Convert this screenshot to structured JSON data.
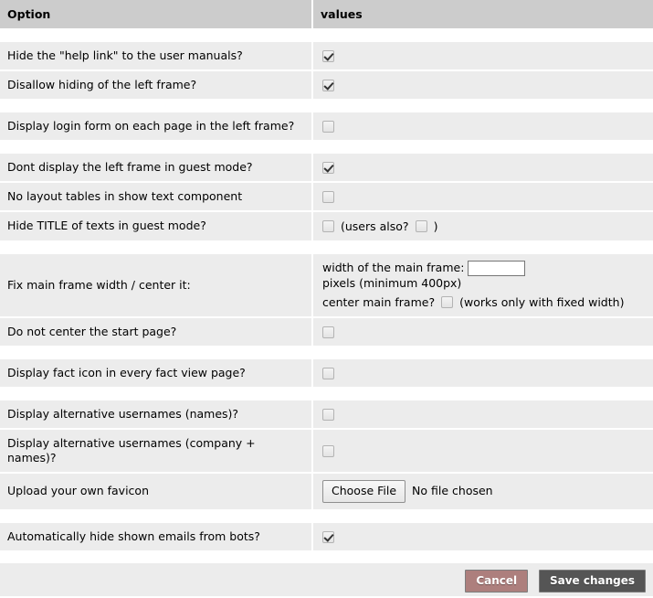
{
  "table": {
    "headers": {
      "option": "Option",
      "values": "values"
    },
    "blocks": [
      {
        "rows": [
          {
            "label": "Hide the \"help link\" to the user manuals?",
            "type": "checkbox",
            "checked": true,
            "name": "hide-help-link"
          },
          {
            "label": "Disallow hiding of the left frame?",
            "type": "checkbox",
            "checked": true,
            "name": "disallow-hiding-left-frame"
          }
        ]
      },
      {
        "rows": [
          {
            "label": "Display login form on each page in the left frame?",
            "type": "checkbox",
            "checked": false,
            "name": "display-login-form-left-frame"
          }
        ]
      },
      {
        "rows": [
          {
            "label": "Dont display the left frame in guest mode?",
            "type": "checkbox",
            "checked": true,
            "name": "hide-left-frame-guest-mode"
          },
          {
            "label": "No layout tables in show text component",
            "type": "checkbox",
            "checked": false,
            "name": "no-layout-tables"
          },
          {
            "label": "Hide TITLE of texts in guest mode?",
            "type": "checkbox-with-extra",
            "checked": false,
            "name": "hide-title-guest-mode",
            "extra_prefix": "(users also?",
            "extra_checked": false,
            "extra_suffix": ")",
            "extra_name": "hide-title-users-also"
          }
        ]
      },
      {
        "rows": [
          {
            "label": "Fix main frame width / center it:",
            "type": "frame-width",
            "name": "fix-main-frame-width",
            "width_label": "width of the main frame:",
            "width_value": "",
            "width_placeholder": "",
            "width_suffix": "pixels (minimum 400px)",
            "center_label": "center main frame?",
            "center_checked": false,
            "center_note": "(works only with fixed width)"
          },
          {
            "label": "Do not center the start page?",
            "type": "checkbox",
            "checked": false,
            "name": "do-not-center-start-page"
          }
        ]
      },
      {
        "rows": [
          {
            "label": "Display fact icon in every fact view page?",
            "type": "checkbox",
            "checked": false,
            "name": "display-fact-icon"
          }
        ]
      },
      {
        "rows": [
          {
            "label": "Display alternative usernames (names)?",
            "type": "checkbox",
            "checked": false,
            "name": "alt-usernames-names"
          },
          {
            "label": "Display alternative usernames (company + names)?",
            "type": "checkbox",
            "checked": false,
            "name": "alt-usernames-company-names"
          },
          {
            "label": "Upload your own favicon",
            "type": "file",
            "name": "upload-favicon",
            "file_button": "Choose File",
            "file_status": "No file chosen"
          }
        ]
      },
      {
        "rows": [
          {
            "label": "Automatically hide shown emails from bots?",
            "type": "checkbox",
            "checked": true,
            "name": "hide-emails-from-bots"
          }
        ]
      }
    ]
  },
  "footer": {
    "cancel_label": "Cancel",
    "save_label": "Save changes"
  },
  "colors": {
    "header_bg": "#cccccc",
    "row_bg": "#ececec",
    "page_bg": "#ffffff",
    "cancel_button": "#ad7f7d",
    "save_button": "#555555"
  }
}
